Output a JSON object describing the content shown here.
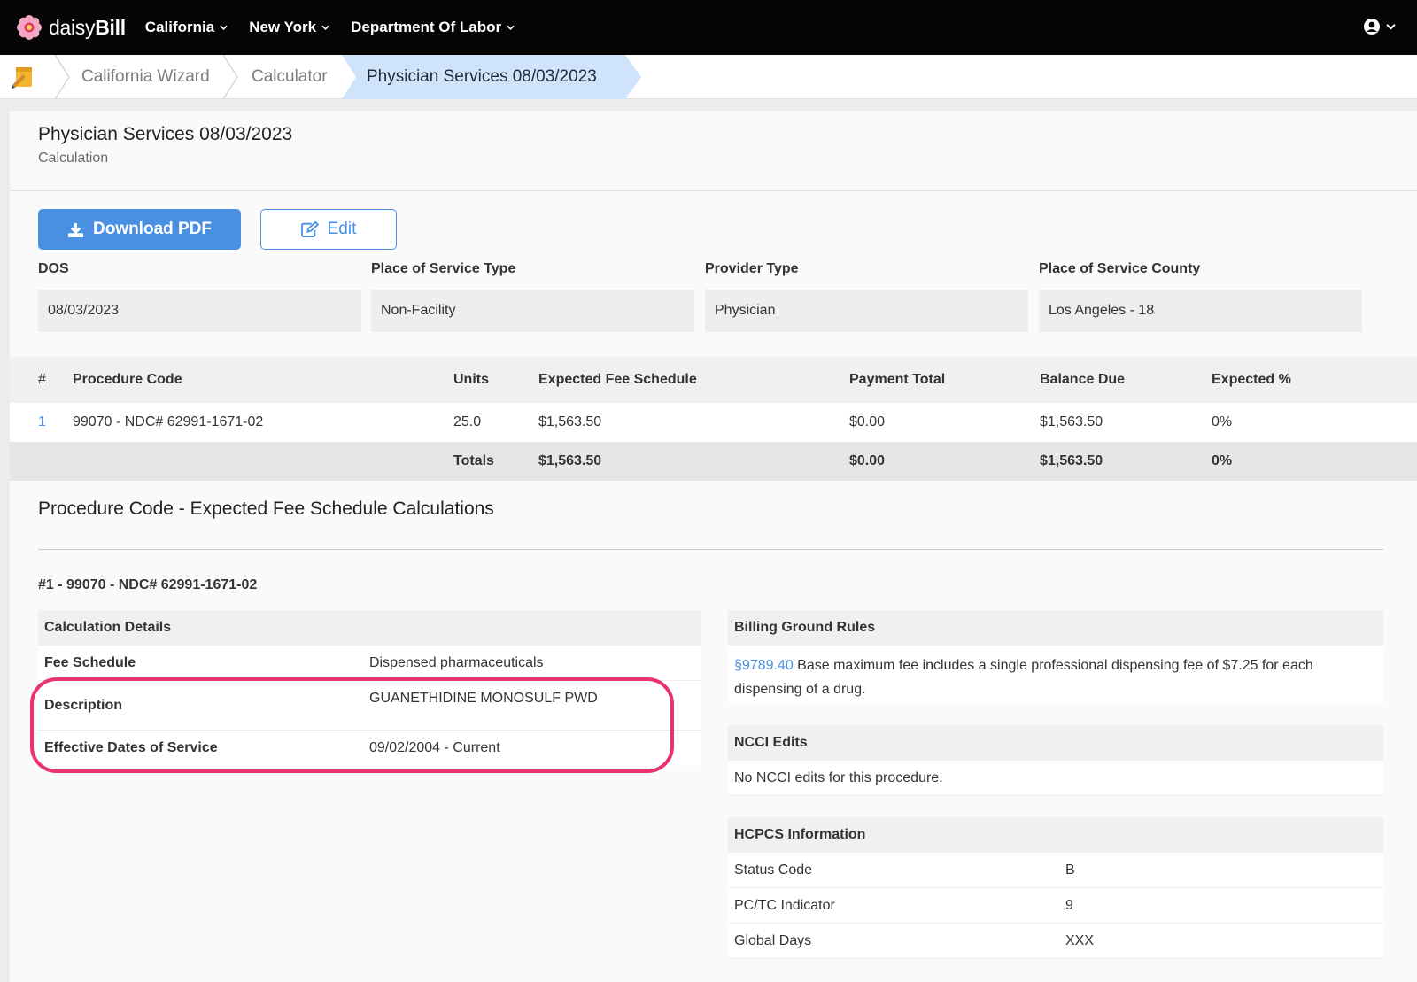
{
  "topnav": {
    "brand_light": "daisy",
    "brand_bold": "Bill",
    "menus": [
      "California",
      "New York",
      "Department Of Labor"
    ]
  },
  "breadcrumb": {
    "items": [
      "California Wizard",
      "Calculator",
      "Physician Services 08/03/2023"
    ]
  },
  "page": {
    "title": "Physician Services 08/03/2023",
    "subtitle": "Calculation"
  },
  "actions": {
    "download_label": "Download PDF",
    "edit_label": "Edit"
  },
  "fields": [
    {
      "label": "DOS",
      "value": "08/03/2023"
    },
    {
      "label": "Place of Service Type",
      "value": "Non-Facility"
    },
    {
      "label": "Provider Type",
      "value": "Physician"
    },
    {
      "label": "Place of Service County",
      "value": "Los Angeles - 18"
    }
  ],
  "procedure_table": {
    "headers": [
      "#",
      "Procedure Code",
      "Units",
      "Expected Fee Schedule",
      "Payment Total",
      "Balance Due",
      "Expected %"
    ],
    "rows": [
      {
        "num": "1",
        "code": "99070 - NDC# 62991-1671-02",
        "units": "25.0",
        "expected_fee": "$1,563.50",
        "payment_total": "$0.00",
        "balance_due": "$1,563.50",
        "expected_pct": "0%"
      }
    ],
    "totals": {
      "label": "Totals",
      "expected_fee": "$1,563.50",
      "payment_total": "$0.00",
      "balance_due": "$1,563.50",
      "expected_pct": "0%"
    }
  },
  "calculations": {
    "section_title": "Procedure Code - Expected Fee Schedule Calculations",
    "item_title": "#1 - 99070 - NDC# 62991-1671-02",
    "details_header": "Calculation Details",
    "details": [
      {
        "key": "Fee Schedule",
        "value": "Dispensed pharmaceuticals"
      },
      {
        "key": "Description",
        "value": "GUANETHIDINE MONOSULF PWD"
      },
      {
        "key": "Effective Dates of Service",
        "value": "09/02/2004 - Current"
      }
    ],
    "ground_rules_header": "Billing Ground Rules",
    "ground_rules_link": "§9789.40",
    "ground_rules_text": " Base maximum fee includes a single professional dispensing fee of $7.25 for each dispensing of a drug.",
    "ncci_header": "NCCI Edits",
    "ncci_text": "No NCCI edits for this procedure.",
    "hcpcs_header": "HCPCS Information",
    "hcpcs": [
      {
        "key": "Status Code",
        "value": "B"
      },
      {
        "key": "PC/TC Indicator",
        "value": "9"
      },
      {
        "key": "Global Days",
        "value": "XXX"
      }
    ]
  },
  "colors": {
    "nav_bg": "#050505",
    "accent": "#4a90e2",
    "active_crumb": "#cfe4fb",
    "highlight": "#e8336e"
  }
}
